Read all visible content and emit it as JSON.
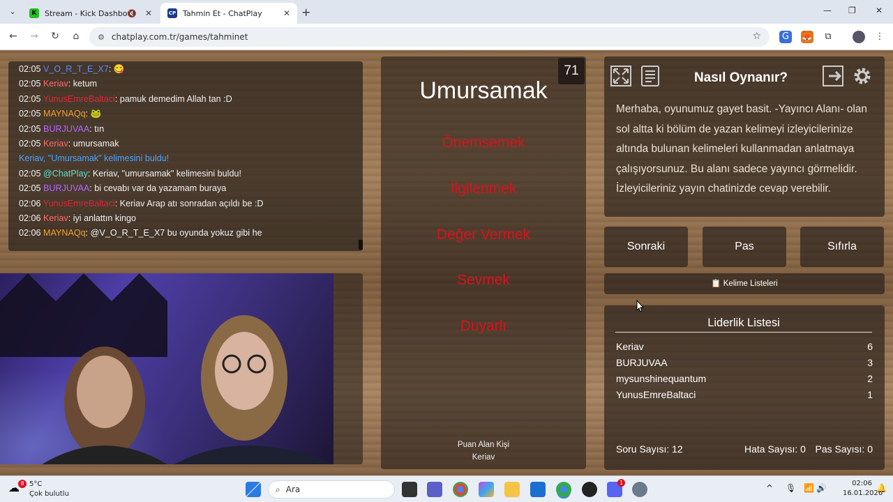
{
  "browser": {
    "tabs": [
      {
        "title": "Stream - Kick Dashboard",
        "favicon": "K"
      },
      {
        "title": "Tahmin Et - ChatPlay",
        "favicon": "CP"
      }
    ],
    "url": "chatplay.com.tr/games/tahminet"
  },
  "chat": {
    "messages": [
      {
        "time": "02:05",
        "user": "V_O_R_T_E_X7",
        "color": "#5a8cff",
        "text": ": 😋"
      },
      {
        "time": "02:05",
        "user": "Keriav",
        "color": "#ff6b6b",
        "text": ": ketum"
      },
      {
        "time": "02:05",
        "user": "YunusEmreBaltaci",
        "color": "#e0283a",
        "text": ": pamuk demedim Allah tan :D"
      },
      {
        "time": "02:05",
        "user": "MAYNAQq",
        "color": "#f0a030",
        "text": ": 🐸"
      },
      {
        "time": "02:05",
        "user": "BURJUVAA",
        "color": "#b566ff",
        "text": ": tın"
      },
      {
        "time": "02:05",
        "user": "Keriav",
        "color": "#ff6b6b",
        "text": ": umursamak"
      },
      {
        "time": "",
        "user": "",
        "color": "#4da3ff",
        "text": "Keriav, \"Umursamak\" kelimesini buldu!"
      },
      {
        "time": "02:05",
        "user": "@ChatPlay",
        "color": "#5ce0d0",
        "text": ": Keriav, \"umursamak\" kelimesini buldu!"
      },
      {
        "time": "02:05",
        "user": "BURJUVAA",
        "color": "#b566ff",
        "text": ": bi cevabı var da yazamam buraya"
      },
      {
        "time": "02:06",
        "user": "YunusEmreBaltaci",
        "color": "#e0283a",
        "text": ": Keriav Arap atı sonradan açıldı be :D"
      },
      {
        "time": "02:06",
        "user": "Keriav",
        "color": "#ff6b6b",
        "text": ": iyi anlattın kingo"
      },
      {
        "time": "02:06",
        "user": "MAYNAQq",
        "color": "#f0a030",
        "text": ": @V_O_R_T_E_X7 bu oyunda yokuz gibi he"
      }
    ]
  },
  "game": {
    "timer": "71",
    "word": "Umursamak",
    "forbidden": [
      "Önemsemek",
      "İlgilenmek",
      "Değer Vermek",
      "Sevmek",
      "Duyarlı"
    ],
    "scorer_label": "Puan Alan Kişi",
    "scorer_name": "Keriav"
  },
  "howto": {
    "title": "Nasıl Oynanır?",
    "text": "Merhaba, oyunumuz gayet basit. -Yayıncı Alanı- olan sol altta ki bölüm de yazan kelimeyi izleyicilerinize altında bulunan kelimeleri kullanmadan anlatmaya çalışıyorsunuz. Bu alanı sadece yayıncı görmelidir. İzleyicileriniz yayın chatinizde cevap verebilir."
  },
  "controls": {
    "next": "Sonraki",
    "pass": "Pas",
    "reset": "Sıfırla",
    "word_lists": "Kelime Listeleri"
  },
  "leaderboard": {
    "title": "Liderlik Listesi",
    "rows": [
      {
        "name": "Keriav",
        "score": "6"
      },
      {
        "name": "BURJUVAA",
        "score": "3"
      },
      {
        "name": "mysunshinequantum",
        "score": "2"
      },
      {
        "name": "YunusEmreBaltaci",
        "score": "1"
      }
    ],
    "questions": "Soru Sayısı: 12",
    "errors": "Hata Sayısı: 0",
    "passes": "Pas Sayısı: 0"
  },
  "taskbar": {
    "temp": "5°C",
    "weather": "Çok bulutlu",
    "weather_badge": "8",
    "search": "Ara",
    "discord_badge": "1",
    "time": "02:06",
    "date": "16.01.2026"
  }
}
